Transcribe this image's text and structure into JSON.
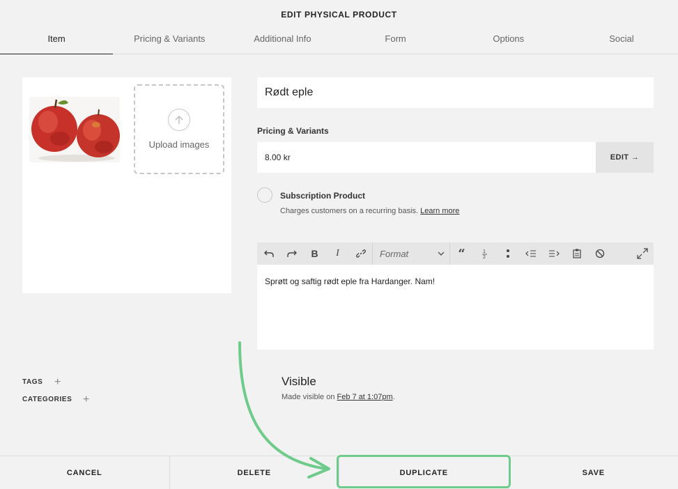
{
  "header": {
    "title": "EDIT PHYSICAL PRODUCT"
  },
  "tabs": [
    {
      "label": "Item",
      "active": true
    },
    {
      "label": "Pricing & Variants"
    },
    {
      "label": "Additional Info"
    },
    {
      "label": "Form"
    },
    {
      "label": "Options"
    },
    {
      "label": "Social"
    }
  ],
  "images": {
    "upload_label": "Upload images",
    "thumbnail": "red-apples-photo"
  },
  "product": {
    "title": "Rødt eple",
    "pricing_label": "Pricing & Variants",
    "price": "8.00 kr",
    "edit_label": "EDIT →"
  },
  "subscription": {
    "title": "Subscription Product",
    "desc": "Charges customers on a recurring basis.",
    "link": "Learn more"
  },
  "editor": {
    "format_label": "Format",
    "content": "Sprøtt og saftig rødt eple fra Hardanger. Nam!"
  },
  "meta": {
    "tags_label": "TAGS",
    "categories_label": "CATEGORIES"
  },
  "visibility": {
    "title": "Visible",
    "desc_prefix": "Made visible on ",
    "date_link": "Feb 7 at 1:07pm",
    "desc_suffix": "."
  },
  "footer": {
    "cancel": "CANCEL",
    "delete": "DELETE",
    "duplicate": "DUPLICATE",
    "save": "SAVE"
  },
  "colors": {
    "highlight": "#6ecb8b",
    "background": "#f2f2f2"
  }
}
